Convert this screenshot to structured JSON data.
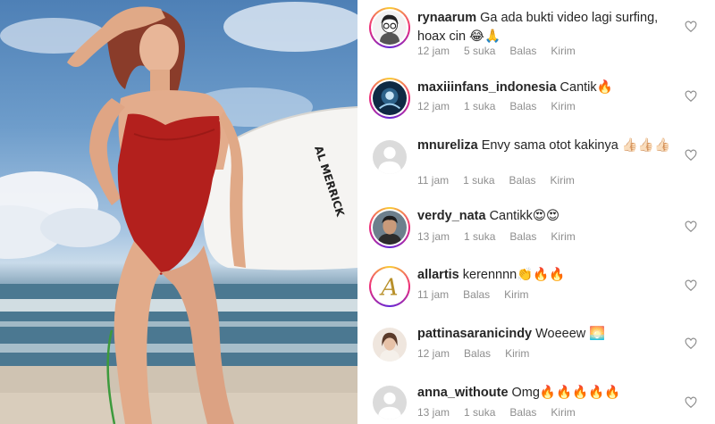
{
  "photo": {
    "description_icon": "photo-of-surfer-woman",
    "surfboard_text": "AL MERRICK"
  },
  "meta_labels": {
    "reply": "Balas",
    "send": "Kirim"
  },
  "comments": [
    {
      "username": "rynaarum",
      "text": "Ga ada bukti video lagi surfing, hoax cin 😂🙏",
      "time": "12 jam",
      "likes": "5 suka",
      "avatar_icon": "glasses-girl-avatar",
      "story_ring": true
    },
    {
      "username": "maxiiinfans_indonesia",
      "text": "Cantik🔥",
      "time": "12 jam",
      "likes": "1 suka",
      "avatar_icon": "fanclub-avatar",
      "story_ring": true
    },
    {
      "username": "mnureliza",
      "text": "Envy sama otot kakinya 👍🏻👍🏻👍🏻",
      "time": "11 jam",
      "likes": "1 suka",
      "avatar_icon": "default-avatar",
      "story_ring": false
    },
    {
      "username": "verdy_nata",
      "text": "Cantikk😍😍",
      "time": "13 jam",
      "likes": "1 suka",
      "avatar_icon": "man-photo-avatar",
      "story_ring": true
    },
    {
      "username": "allartis",
      "text": "kerennnn👏🔥🔥",
      "time": "11 jam",
      "likes": "",
      "avatar_icon": "letter-a-avatar",
      "story_ring": true
    },
    {
      "username": "pattinasaranicindy",
      "text": "Woeeew 🌅",
      "time": "12 jam",
      "likes": "",
      "avatar_icon": "woman-photo-avatar",
      "story_ring": false
    },
    {
      "username": "anna_withoute",
      "text": "Omg🔥🔥🔥🔥🔥",
      "time": "13 jam",
      "likes": "1 suka",
      "avatar_icon": "default-avatar",
      "story_ring": false
    }
  ]
}
